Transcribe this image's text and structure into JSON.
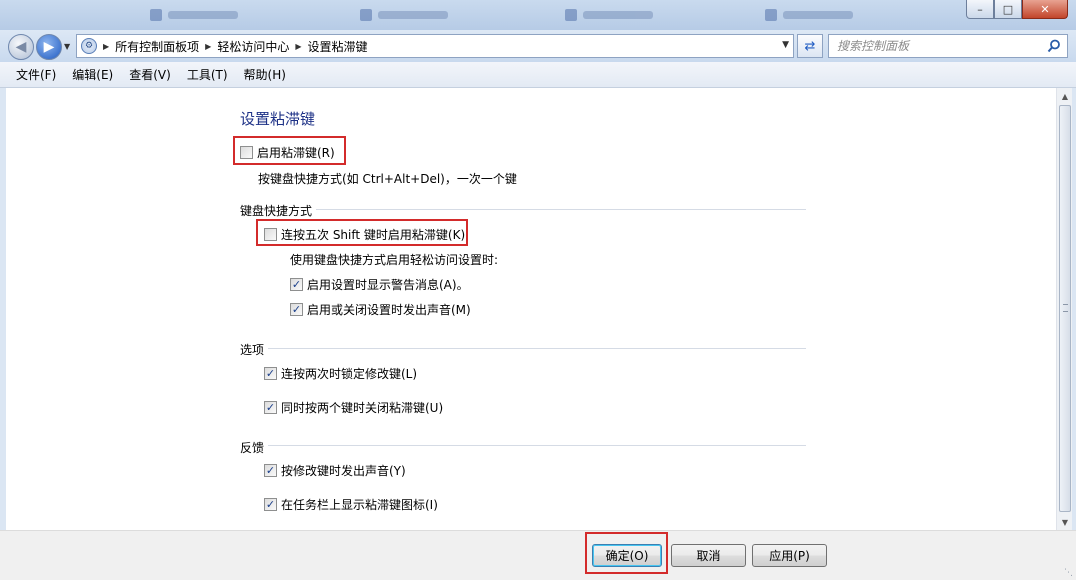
{
  "window": {
    "minimize": "–",
    "maximize": "□",
    "close": "✕"
  },
  "nav": {
    "back_icon": "back-arrow-icon",
    "forward_icon": "forward-arrow-icon",
    "breadcrumb": [
      "所有控制面板项",
      "轻松访问中心",
      "设置粘滞键"
    ],
    "search_placeholder": "搜索控制面板"
  },
  "menu": [
    "文件(F)",
    "编辑(E)",
    "查看(V)",
    "工具(T)",
    "帮助(H)"
  ],
  "page": {
    "title": "设置粘滞键",
    "enable_sticky": {
      "label": "启用粘滞键(R)",
      "checked": false
    },
    "enable_desc": "按键盘快捷方式(如 Ctrl+Alt+Del)，一次一个键",
    "sections": {
      "shortcut": {
        "heading": "键盘快捷方式",
        "shift5": {
          "label": "连按五次 Shift 键时启用粘滞键(K)",
          "checked": false
        },
        "sub_desc": "使用键盘快捷方式启用轻松访问设置时:",
        "warn": {
          "label": "启用设置时显示警告消息(A)。",
          "checked": true
        },
        "sound": {
          "label": "启用或关闭设置时发出声音(M)",
          "checked": true
        }
      },
      "options": {
        "heading": "选项",
        "lock": {
          "label": "连按两次时锁定修改键(L)",
          "checked": true
        },
        "turnoff": {
          "label": "同时按两个键时关闭粘滞键(U)",
          "checked": true
        }
      },
      "feedback": {
        "heading": "反馈",
        "beep": {
          "label": "按修改键时发出声音(Y)",
          "checked": true
        },
        "taskbar": {
          "label": "在任务栏上显示粘滞键图标(I)",
          "checked": true
        }
      }
    }
  },
  "buttons": {
    "ok": "确定(O)",
    "cancel": "取消",
    "apply": "应用(P)"
  },
  "colors": {
    "highlight": "#d32b2b",
    "title_text": "#1e3287"
  }
}
